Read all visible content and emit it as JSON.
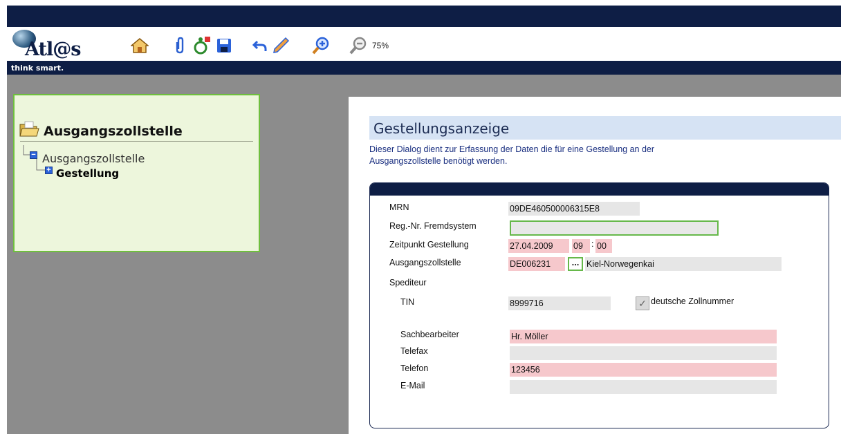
{
  "app": {
    "logo_text": "Atl@s",
    "tagline": "think smart."
  },
  "toolbar": {
    "icons": [
      "home-icon",
      "attachment-icon",
      "accessibility-icon",
      "save-icon",
      "undo-icon",
      "edit-pencil-icon",
      "zoom-in-icon",
      "zoom-out-icon"
    ],
    "zoom_level": "75%"
  },
  "tree": {
    "title": "Ausgangszollstelle",
    "node_root": "Ausgangszollstelle",
    "node_child": "Gestellung"
  },
  "content": {
    "heading": "Gestellungsanzeige",
    "description_line1": "Dieser Dialog dient zur Erfassung der Daten die für eine Gestellung an der",
    "description_line2": "Ausgangszollstelle benötigt werden."
  },
  "form": {
    "mrn_label": "MRN",
    "mrn_value": "09DE460500006315E8",
    "regnr_label": "Reg.-Nr. Fremdsystem",
    "regnr_value": "",
    "zeitpunkt_label": "Zeitpunkt Gestellung",
    "zeitpunkt_date": "27.04.2009",
    "zeitpunkt_hour": "09",
    "zeitpunkt_sep": ":",
    "zeitpunkt_minute": "00",
    "ausgangszollstelle_label": "Ausgangszollstelle",
    "ausgangszollstelle_code": "DE006231",
    "lookup_button": "...",
    "ausgangszollstelle_name": "Kiel-Norwegenkai",
    "spediteur_label": "Spediteur",
    "tin_label": "TIN",
    "tin_value": "8999716",
    "deutsche_zollnummer_label": "deutsche Zollnummer",
    "deutsche_zollnummer_checked": true,
    "sachbearbeiter_label": "Sachbearbeiter",
    "sachbearbeiter_value": "Hr. Möller",
    "telefax_label": "Telefax",
    "telefax_value": "",
    "telefon_label": "Telefon",
    "telefon_value": "123456",
    "email_label": "E-Mail",
    "email_value": ""
  },
  "colors": {
    "header_navy": "#0e1e45",
    "tree_panel_bg": "#edf6dc",
    "tree_panel_border": "#6fbf3e",
    "required_field_pink": "#f6c8cc",
    "readonly_field_gray": "#e6e6e6",
    "heading_bar_blue": "#d6e3f4"
  }
}
